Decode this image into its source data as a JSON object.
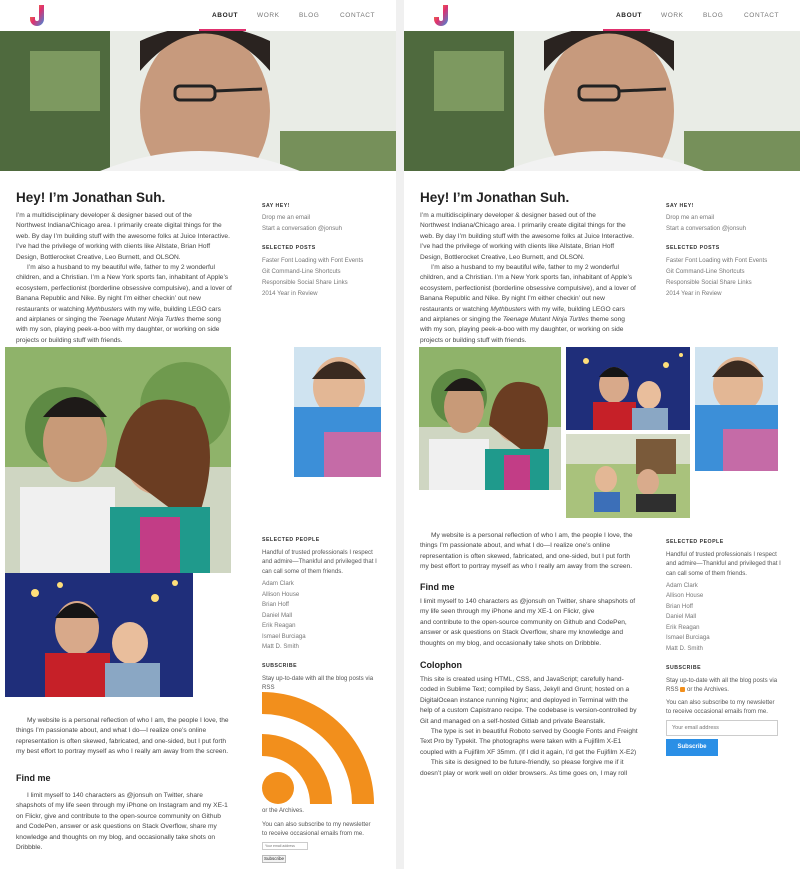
{
  "nav": {
    "items": [
      "ABOUT",
      "WORK",
      "BLOG",
      "CONTACT"
    ],
    "active": "ABOUT"
  },
  "colors": {
    "accent": "#e0306e",
    "link": "#777777",
    "button": "#2a8fe6",
    "rss": "#f28f1c"
  },
  "intro": {
    "heading": "Hey! I’m Jonathan Suh.",
    "lines_left": [
      "I’m a multidisciplinary developer & designer based out of the",
      "Northwest Indiana/Chicago area. I primarily create digital things for the",
      "web. By day I’m building stuff with the awesome folks at Juice Interactive.",
      "I’ve had the privilege of working with clients like Allstate, Brian Hoff",
      "Design, Bottlerocket Creative, Leo Burnett, and OLSON.",
      "      I’m also a husband to my beautiful wife, father to my 2 wonderful",
      "children, and a Christian. I’m a New York sports fan, inhabitant of Apple’s",
      "ecosystem, perfectionist (borderline obsessive compulsive), and a lover of",
      "Banana Republic and Nike. By night I’m either checkin’ out new",
      "restaurants or watching ",
      "Mythbusters",
      " with my wife, building LEGO cars",
      "and airplanes or singing the ",
      "Teenage Mutant Ninja Turtles",
      " theme song",
      "with my son, playing peek-a-boo with my daughter, or working on side",
      "projects or building stuff with friends."
    ]
  },
  "reflection": {
    "left_lines": [
      "      My website is a personal reflection of who I am, the people I love, the",
      "things I’m passionate about, and what I do—I realize one’s online",
      "representation is often skewed, fabricated, and one-sided, but I put forth",
      "my best effort to portray myself as who I really am away from the screen."
    ]
  },
  "findme": {
    "heading": "Find me",
    "left_lines": [
      "      I limit myself to 140 characters as @jonsuh on Twitter, share",
      "shapshots of my life seen through my iPhone on Instagram and my XE-1",
      "on Flickr, give and contribute to the open-source community on Github",
      "and CodePen, answer or ask questions on Stack Overflow, share my",
      "knowledge and thoughts on my blog, and occasionally take shots on",
      "Dribbble."
    ],
    "right_lines": [
      "I limit myself to 140 characters as @jonsuh on Twitter, share shapshots of",
      "my life seen through my iPhone and my XE-1 on Flickr, give",
      "and contribute to the open-source community on Github and CodePen,",
      "answer or ask questions on Stack Overflow, share my knowledge and",
      "thoughts on my blog, and occasionally take shots on Dribbble."
    ]
  },
  "colophon": {
    "heading": "Colophon",
    "lines": [
      "This site is created using HTML, CSS, and JavaScript; carefully hand-",
      "coded in Sublime Text; compiled by Sass, Jekyll and Grunt; hosted on a",
      "DigitalOcean instance running Nginx; and deployed in Terminal with the",
      "help of a custom Capistrano recipe. The codebase is version-controlled by",
      "Git and managed on a self-hosted Gitlab and private Beanstalk.",
      "      The type is set in beautiful Roboto served by Google Fonts and Freight",
      "Text Pro by Typekit. The photographs were taken with a Fujifilm X-E1",
      "coupled with a Fujifilm XF 35mm. (If I did it again, I’d get the Fujifilm X-E2)",
      "      This site is designed to be future-friendly, so please forgive me if it",
      "doesn’t play or work well on older browsers. As time goes on, I may roll"
    ]
  },
  "sidebar": {
    "say_hey": {
      "heading": "SAY HEY!",
      "links": [
        "Drop me an email",
        "Start a conversation @jonsuh"
      ]
    },
    "selected_posts": {
      "heading": "SELECTED POSTS",
      "links": [
        "Faster Font Loading with Font Events",
        "Git Command-Line Shortcuts",
        "Responsible Social Share Links",
        "2014 Year in Review"
      ]
    },
    "selected_people": {
      "heading": "SELECTED PEOPLE",
      "desc_lines": [
        "Handful of trusted professionals I respect",
        "and admire—Thankful and privileged that I",
        "can call some of them friends."
      ],
      "links": [
        "Adam Clark",
        "Allison House",
        "Brian Hoff",
        "Daniel Mall",
        "Erik Reagan",
        "Ismael Burciaga",
        "Matt D. Smith"
      ]
    },
    "subscribe": {
      "heading": "SUBSCRIBE",
      "desc_left_lines": [
        "Stay up-to-date with all the blog posts via",
        "RSS"
      ],
      "or_archives_left": "or the Archives.",
      "desc_right_line1": "Stay up-to-date with all the blog posts via",
      "rss_word": "RSS",
      "or_archives_right": "or the Archives.",
      "newsletter_lines": [
        "You can also subscribe to my newsletter",
        "to receive occasional emails from me."
      ],
      "email_placeholder": "Your email address",
      "button_label": "Subscribe"
    }
  }
}
